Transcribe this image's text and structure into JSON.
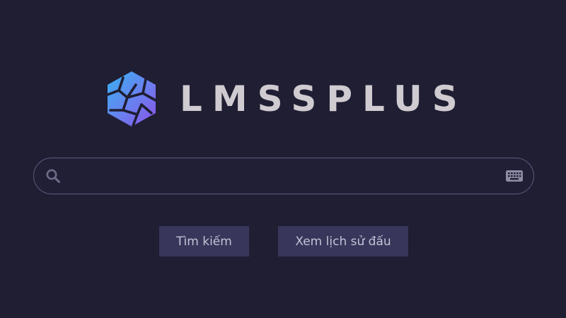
{
  "brand": {
    "name": "LMSSPLUS",
    "logo_icon": "crystal-hexagon-logo",
    "colors": {
      "gradient_start": "#37b2f2",
      "gradient_end": "#8a53e8",
      "text": "#cfcbd0",
      "background": "#1f1e33"
    }
  },
  "search": {
    "placeholder": "",
    "value": "",
    "icons": {
      "left": "search-icon",
      "right": "keyboard-icon"
    }
  },
  "buttons": {
    "search_label": "Tìm kiếm",
    "history_label": "Xem lịch sử đấu",
    "color": "#38365a"
  }
}
